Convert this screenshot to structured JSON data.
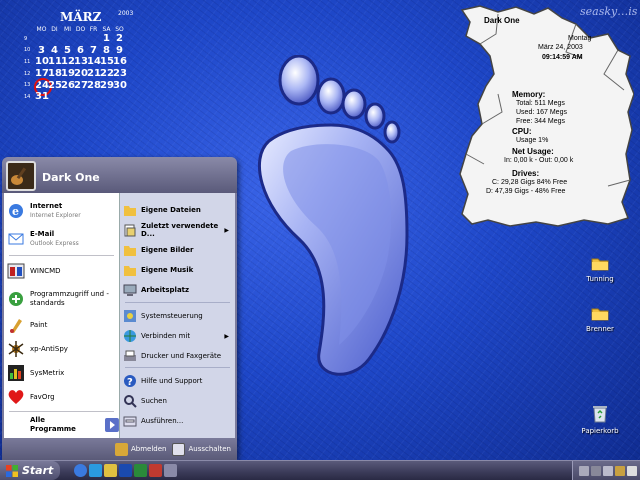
{
  "calendar": {
    "month": "MÄRZ",
    "year": "2003",
    "day_headers": [
      "MO",
      "DI",
      "MI",
      "DO",
      "FR",
      "SA",
      "SO"
    ],
    "weeks": [
      {
        "num": "9",
        "days": [
          "",
          "",
          "",
          "",
          "",
          "1",
          "2"
        ]
      },
      {
        "num": "10",
        "days": [
          "3",
          "4",
          "5",
          "6",
          "7",
          "8",
          "9"
        ]
      },
      {
        "num": "11",
        "days": [
          "10",
          "11",
          "12",
          "13",
          "14",
          "15",
          "16"
        ]
      },
      {
        "num": "12",
        "days": [
          "17",
          "18",
          "19",
          "20",
          "21",
          "22",
          "23"
        ]
      },
      {
        "num": "13",
        "days": [
          "24",
          "25",
          "26",
          "27",
          "28",
          "29",
          "30"
        ]
      },
      {
        "num": "14",
        "days": [
          "31",
          "",
          "",
          "",
          "",
          "",
          ""
        ]
      }
    ],
    "today": "24"
  },
  "signature": "seasky…is",
  "sysinfo": {
    "title": "Dark One",
    "weekday": "Montag",
    "date": "März 24, 2003",
    "time": "09:14:59 AM",
    "memory_label": "Memory:",
    "memory_total": "Total: 511 Megs",
    "memory_used": "Used: 167 Megs",
    "memory_free": "Free: 344 Megs",
    "cpu_label": "CPU:",
    "cpu_usage": "Usage 1%",
    "net_label": "Net Usage:",
    "net_value": "In: 0,00 k - Out: 0,00 k",
    "drives_label": "Drives:",
    "drive_c": "C: 29,28 Gigs 84% Free",
    "drive_d": "D: 47,39 Gigs - 48% Free"
  },
  "desktop_icons": {
    "tuning": "Tunning",
    "brenner": "Brenner",
    "papierkorb": "Papierkorb"
  },
  "start_menu": {
    "user_name": "Dark One",
    "pinned": [
      {
        "title": "Internet",
        "subtitle": "Internet Explorer"
      },
      {
        "title": "E-Mail",
        "subtitle": "Outlook Express"
      }
    ],
    "recent": [
      "WINCMD",
      "Programmzugriff und -standards",
      "Paint",
      "xp-AntiSpy",
      "SysMetrix",
      "FavOrg"
    ],
    "all_programs": "Alle Programme",
    "right_items": [
      "Eigene Dateien",
      "Zuletzt verwendete D...",
      "Eigene Bilder",
      "Eigene Musik",
      "Arbeitsplatz",
      "Systemsteuerung",
      "Verbinden mit",
      "Drucker und Faxgeräte",
      "Hilfe und Support",
      "Suchen",
      "Ausführen..."
    ],
    "logoff": "Abmelden",
    "shutdown": "Ausschalten"
  },
  "taskbar": {
    "start_label": "Start"
  },
  "colors": {
    "desktop": "#1e47c8",
    "today_ring": "#e01010",
    "start_header": "#6a6a8a"
  }
}
